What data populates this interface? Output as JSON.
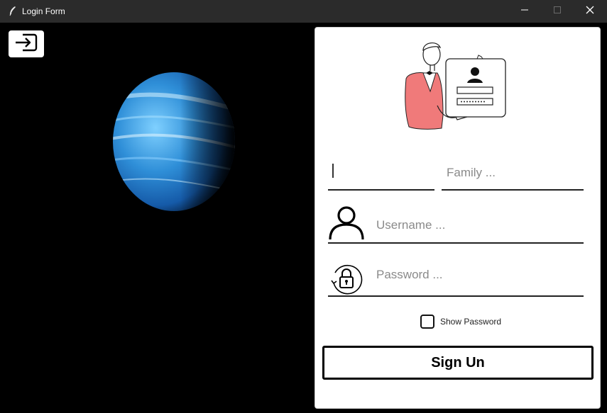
{
  "window": {
    "title": "Login Form",
    "controls": {
      "minimize_icon": "minimize-icon",
      "maximize_icon": "maximize-icon",
      "close_icon": "close-icon"
    }
  },
  "left_panel": {
    "exit_icon": "exit-icon",
    "image": "planet"
  },
  "form": {
    "illustration": "person-holding-login-card",
    "first_name": {
      "value": "",
      "placeholder": ""
    },
    "family": {
      "placeholder": "Family ..."
    },
    "username": {
      "placeholder": "Username ...",
      "icon": "user-icon"
    },
    "password": {
      "placeholder": "Password ...",
      "icon": "lock-icon"
    },
    "show_password": {
      "label": "Show Password",
      "checked": false
    },
    "submit_label": "Sign Un"
  },
  "colors": {
    "titlebar": "#2b2b2b",
    "panel": "#ffffff",
    "planet": "#2f8fd8",
    "illustration_jacket": "#f07a7a"
  }
}
